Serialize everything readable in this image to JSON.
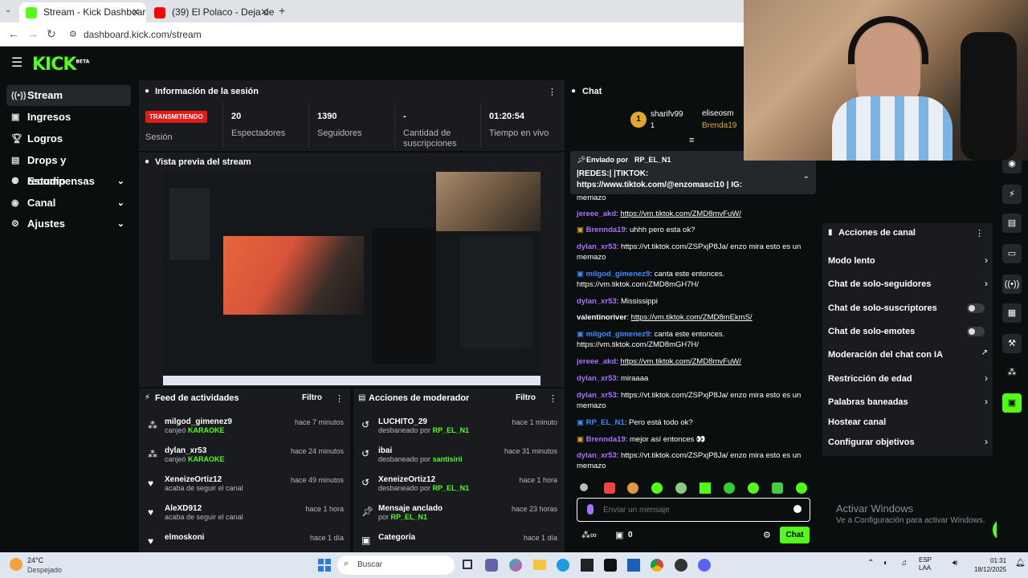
{
  "browser": {
    "tabs": [
      {
        "title": "Stream - Kick Dashboard",
        "active": true,
        "color": "#53fc18"
      },
      {
        "title": "(39) El Polaco - Deja de llorar -",
        "active": false,
        "color": "#ff0000"
      }
    ],
    "url": "dashboard.kick.com/stream"
  },
  "app": {
    "logo": "KICK",
    "logo_tag": "BETA",
    "accent": "#53fc18"
  },
  "sidebar": {
    "items": [
      {
        "label": "Stream",
        "icon": "live-icon",
        "active": true
      },
      {
        "label": "Ingresos",
        "icon": "money-icon"
      },
      {
        "label": "Logros",
        "icon": "trophy-icon"
      },
      {
        "label": "Drops y recompensas",
        "icon": "gift-icon"
      },
      {
        "label": "Estudio",
        "icon": "studio-icon",
        "chevron": "⌄"
      },
      {
        "label": "Canal",
        "icon": "channel-icon",
        "chevron": "⌄"
      },
      {
        "label": "Ajustes",
        "icon": "gear-icon",
        "chevron": "⌄"
      }
    ]
  },
  "session": {
    "title": "Información de la sesión",
    "status": "TRANSMITIENDO",
    "status_label": "Sesión",
    "stats": [
      {
        "value": "20",
        "label": "Espectadores"
      },
      {
        "value": "1390",
        "label": "Seguidores"
      },
      {
        "value": "-",
        "label": "Cantidad de suscripciones"
      },
      {
        "value": "01:20:54",
        "label": "Tiempo en vivo"
      }
    ]
  },
  "preview": {
    "title": "Vista previa del stream"
  },
  "feed": {
    "title": "Feed de actividades",
    "filter": "Filtro",
    "items": [
      {
        "name": "milgod_gimenez9",
        "prefix": "canjeó",
        "detail": "KARAOKE",
        "time": "hace 7 minutos"
      },
      {
        "name": "dylan_xr53",
        "prefix": "canjeó",
        "detail": "KARAOKE",
        "time": "hace 24 minutos"
      },
      {
        "name": "XeneizeOrtiz12",
        "prefix": "acaba de seguir el canal",
        "detail": "",
        "time": "hace 49 minutos"
      },
      {
        "name": "AleXD912",
        "prefix": "acaba de seguir el canal",
        "detail": "",
        "time": "hace 1 hora"
      },
      {
        "name": "elmoskoni",
        "prefix": "",
        "detail": "",
        "time": "hace 1 día"
      }
    ]
  },
  "modactions": {
    "title": "Acciones de moderador",
    "filter": "Filtro",
    "items": [
      {
        "name": "LUCHITO_29",
        "prefix": "desbaneado por",
        "detail": "RP_EL_N1",
        "time": "hace 1 minuto"
      },
      {
        "name": "ibai",
        "prefix": "desbaneado por",
        "detail": "santisirii",
        "time": "hace 31 minutos"
      },
      {
        "name": "XeneizeOrtiz12",
        "prefix": "desbaneado por",
        "detail": "RP_EL_N1",
        "time": "hace 1 hora"
      },
      {
        "name": "Mensaje anclado",
        "prefix": "por",
        "detail": "RP_EL_N1",
        "time": "hace 23 horas"
      },
      {
        "name": "Categoría",
        "prefix": "",
        "detail": "",
        "time": "hace 1 día"
      }
    ]
  },
  "chat": {
    "title": "Chat",
    "top_users": [
      {
        "name": "sharifv99",
        "count": "1"
      },
      {
        "name": "eliseosm",
        "count": ""
      },
      {
        "name": "Brenda19",
        "count": ""
      }
    ],
    "pinned": {
      "by_label": "Enviado por",
      "by_user": "RP_EL_N1",
      "text": "|REDES:| |TIKTOK: https://www.tiktok.com/@enzomasci10 | IG: https://www.instagram.com/enzo.mascii/ | YT:..."
    },
    "messages": [
      {
        "user": "",
        "text": "memazo"
      },
      {
        "user": "jereee_akd",
        "text": "https://vm.tiktok.com/ZMD8mvFuW/"
      },
      {
        "user": "Brennda19",
        "text": "uhhh pero esta ok?"
      },
      {
        "user": "dylan_xr53",
        "text": "https://vt.tiktok.com/ZSPxjP8Ja/ enzo mira esto es un memazo"
      },
      {
        "user": "milgod_gimenez9",
        "text": "canta este entonces. https://vm.tiktok.com/ZMD8mGH7H/"
      },
      {
        "user": "dylan_xr53",
        "text": "Mississippi"
      },
      {
        "user": "valentinoriver",
        "text": "https://vm.tiktok.com/ZMD8mEkmS/"
      },
      {
        "user": "milgod_gimenez9",
        "text": "canta este entonces. https://vm.tiktok.com/ZMD8mGH7H/"
      },
      {
        "user": "jereee_akd",
        "text": "https://vm.tiktok.com/ZMD8mvFuW/"
      },
      {
        "user": "dylan_xr53",
        "text": "miraaaa"
      },
      {
        "user": "dylan_xr53",
        "text": "https://vt.tiktok.com/ZSPxjP8Ja/ enzo mira esto es un memazo"
      },
      {
        "user": "RP_EL_N1",
        "text": "Pero está todo ok?"
      },
      {
        "user": "Brennda19",
        "text": "mejor así entonces 👀"
      },
      {
        "user": "dylan_xr53",
        "text": "https://vt.tiktok.com/ZSPxjP8Ja/ enzo mira esto es un memazo"
      }
    ],
    "placeholder": "Enviar un mensaje",
    "points": "0",
    "send": "Chat"
  },
  "channel_actions": {
    "title": "Acciones de canal",
    "items": [
      {
        "label": "Modo lento",
        "control": "chevron"
      },
      {
        "label": "Chat de solo-seguidores",
        "control": "chevron"
      },
      {
        "label": "Chat de solo-suscriptores",
        "control": "toggle"
      },
      {
        "label": "Chat de solo-emotes",
        "control": "toggle"
      },
      {
        "label": "Moderación del chat con IA",
        "control": "external"
      },
      {
        "label": "Restricción de edad",
        "control": "chevron"
      },
      {
        "label": "Palabras baneadas",
        "control": "chevron"
      },
      {
        "label": "Hostear canal",
        "control": "none"
      },
      {
        "label": "Configurar objetivos",
        "control": "chevron"
      }
    ]
  },
  "watermark": {
    "line1": "Activar Windows",
    "line2": "Ve a Configuración para activar Windows."
  },
  "taskbar": {
    "weather_temp": "24°C",
    "weather_desc": "Despejado",
    "search": "Buscar",
    "lang1": "ESP",
    "lang2": "LAA",
    "time": "01:31",
    "date": "18/12/2025"
  }
}
